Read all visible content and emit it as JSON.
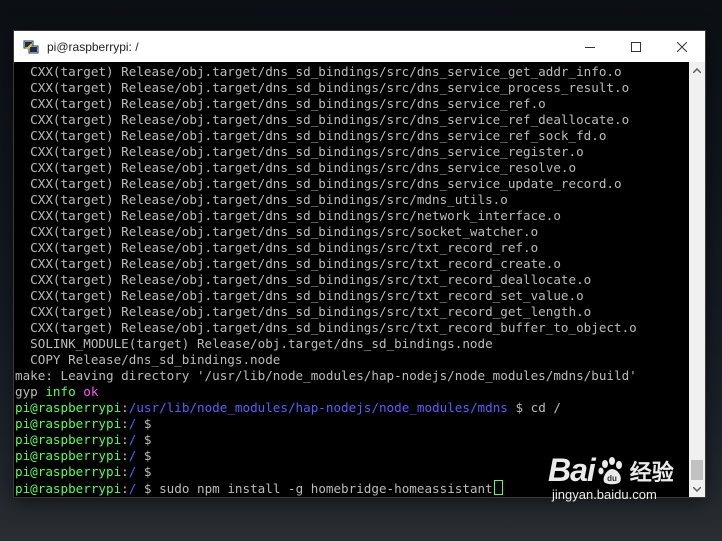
{
  "window": {
    "title": "pi@raspberrypi: /"
  },
  "terminal": {
    "lines": [
      [
        {
          "t": "  CXX(target) Release/obj.target/dns_sd_bindings/src/dns_service_get_addr_info.o",
          "c": "w"
        }
      ],
      [
        {
          "t": "  CXX(target) Release/obj.target/dns_sd_bindings/src/dns_service_process_result.o",
          "c": "w"
        }
      ],
      [
        {
          "t": "  CXX(target) Release/obj.target/dns_sd_bindings/src/dns_service_ref.o",
          "c": "w"
        }
      ],
      [
        {
          "t": "  CXX(target) Release/obj.target/dns_sd_bindings/src/dns_service_ref_deallocate.o",
          "c": "w"
        }
      ],
      [
        {
          "t": "  CXX(target) Release/obj.target/dns_sd_bindings/src/dns_service_ref_sock_fd.o",
          "c": "w"
        }
      ],
      [
        {
          "t": "  CXX(target) Release/obj.target/dns_sd_bindings/src/dns_service_register.o",
          "c": "w"
        }
      ],
      [
        {
          "t": "  CXX(target) Release/obj.target/dns_sd_bindings/src/dns_service_resolve.o",
          "c": "w"
        }
      ],
      [
        {
          "t": "  CXX(target) Release/obj.target/dns_sd_bindings/src/dns_service_update_record.o",
          "c": "w"
        }
      ],
      [
        {
          "t": "  CXX(target) Release/obj.target/dns_sd_bindings/src/mdns_utils.o",
          "c": "w"
        }
      ],
      [
        {
          "t": "  CXX(target) Release/obj.target/dns_sd_bindings/src/network_interface.o",
          "c": "w"
        }
      ],
      [
        {
          "t": "  CXX(target) Release/obj.target/dns_sd_bindings/src/socket_watcher.o",
          "c": "w"
        }
      ],
      [
        {
          "t": "  CXX(target) Release/obj.target/dns_sd_bindings/src/txt_record_ref.o",
          "c": "w"
        }
      ],
      [
        {
          "t": "  CXX(target) Release/obj.target/dns_sd_bindings/src/txt_record_create.o",
          "c": "w"
        }
      ],
      [
        {
          "t": "  CXX(target) Release/obj.target/dns_sd_bindings/src/txt_record_deallocate.o",
          "c": "w"
        }
      ],
      [
        {
          "t": "  CXX(target) Release/obj.target/dns_sd_bindings/src/txt_record_set_value.o",
          "c": "w"
        }
      ],
      [
        {
          "t": "  CXX(target) Release/obj.target/dns_sd_bindings/src/txt_record_get_length.o",
          "c": "w"
        }
      ],
      [
        {
          "t": "  CXX(target) Release/obj.target/dns_sd_bindings/src/txt_record_buffer_to_object.o",
          "c": "w"
        }
      ],
      [
        {
          "t": "  SOLINK_MODULE(target) Release/obj.target/dns_sd_bindings.node",
          "c": "w"
        }
      ],
      [
        {
          "t": "  COPY Release/dns_sd_bindings.node",
          "c": "w"
        }
      ],
      [
        {
          "t": "make: Leaving directory '/usr/lib/node_modules/hap-nodejs/node_modules/mdns/build'",
          "c": "w"
        }
      ],
      [
        {
          "t": "gyp ",
          "c": "w"
        },
        {
          "t": "info",
          "c": "g"
        },
        {
          "t": " ",
          "c": "w"
        },
        {
          "t": "ok",
          "c": "m"
        },
        {
          "t": " ",
          "c": "w"
        }
      ],
      [
        {
          "t": "pi@raspberrypi",
          "c": "g"
        },
        {
          "t": ":",
          "c": "w"
        },
        {
          "t": "/usr/lib/node_modules/hap-nodejs/node_modules/mdns",
          "c": "b"
        },
        {
          "t": " $ cd /",
          "c": "w"
        }
      ],
      [
        {
          "t": "pi@raspberrypi",
          "c": "g"
        },
        {
          "t": ":",
          "c": "w"
        },
        {
          "t": "/",
          "c": "b"
        },
        {
          "t": " $",
          "c": "w"
        }
      ],
      [
        {
          "t": "pi@raspberrypi",
          "c": "g"
        },
        {
          "t": ":",
          "c": "w"
        },
        {
          "t": "/",
          "c": "b"
        },
        {
          "t": " $",
          "c": "w"
        }
      ],
      [
        {
          "t": "pi@raspberrypi",
          "c": "g"
        },
        {
          "t": ":",
          "c": "w"
        },
        {
          "t": "/",
          "c": "b"
        },
        {
          "t": " $",
          "c": "w"
        }
      ],
      [
        {
          "t": "pi@raspberrypi",
          "c": "g"
        },
        {
          "t": ":",
          "c": "w"
        },
        {
          "t": "/",
          "c": "b"
        },
        {
          "t": " $",
          "c": "w"
        }
      ],
      [
        {
          "t": "pi@raspberrypi",
          "c": "g"
        },
        {
          "t": ":",
          "c": "w"
        },
        {
          "t": "/",
          "c": "b"
        },
        {
          "t": " $ sudo npm install -g homebridge-homeassistant",
          "c": "w"
        }
      ]
    ]
  },
  "watermark": {
    "brand_left": "Bai",
    "brand_right": "经验",
    "url": "jingyan.baidu.com"
  },
  "colors": {
    "prompt_user": "#54ff54",
    "prompt_path": "#5c5cff",
    "text": "#bbbbbb",
    "ok": "#ff54ff"
  }
}
